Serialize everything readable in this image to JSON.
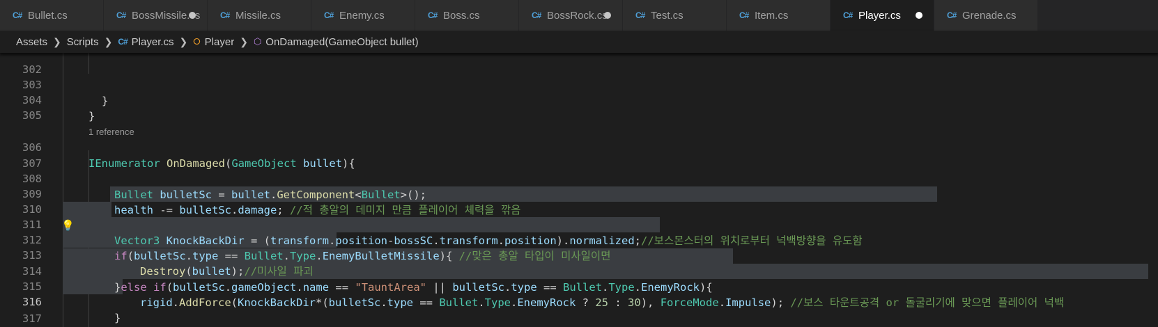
{
  "tabs": [
    {
      "label": "Bullet.cs",
      "modified": false,
      "active": false
    },
    {
      "label": "BossMissile.cs",
      "modified": true,
      "active": false
    },
    {
      "label": "Missile.cs",
      "modified": false,
      "active": false
    },
    {
      "label": "Enemy.cs",
      "modified": false,
      "active": false
    },
    {
      "label": "Boss.cs",
      "modified": false,
      "active": false
    },
    {
      "label": "BossRock.cs",
      "modified": true,
      "active": false
    },
    {
      "label": "Test.cs",
      "modified": false,
      "active": false
    },
    {
      "label": "Item.cs",
      "modified": false,
      "active": false
    },
    {
      "label": "Player.cs",
      "modified": true,
      "active": true
    },
    {
      "label": "Grenade.cs",
      "modified": false,
      "active": false
    }
  ],
  "tab_icon_text": "C#",
  "breadcrumb": {
    "folder1": "Assets",
    "folder2": "Scripts",
    "file": "Player.cs",
    "class": "Player",
    "method": "OnDamaged(GameObject bullet)"
  },
  "codelens": "1 reference",
  "line_numbers": [
    "302",
    "303",
    "304",
    "305",
    "306",
    "307",
    "308",
    "309",
    "310",
    "311",
    "312",
    "313",
    "314",
    "315",
    "316",
    "317"
  ],
  "code": {
    "l303": "}",
    "l304": "}",
    "l306": {
      "t1": "IEnumerator",
      "t2": "OnDamaged",
      "t3": "(",
      "t4": "GameObject",
      "t5": "bullet",
      "t6": "){"
    },
    "l308": {
      "t1": "Bullet",
      "t2": "bulletSc",
      "t3": " = ",
      "t4": "bullet",
      "t5": ".",
      "t6": "GetComponent",
      "t7": "<",
      "t8": "Bullet",
      "t9": ">();"
    },
    "l309": {
      "t1": "health",
      "t2": " -= ",
      "t3": "bulletSc",
      "t4": ".",
      "t5": "damage",
      "t6": "; ",
      "t7": "//적 총알의 데미지 만큼 플레이어 체력을 깎음"
    },
    "l310": {
      "t1": "Vector3",
      "t2": "KnockBackDir",
      "t3": " = (",
      "t4": "transform",
      "t5": ".",
      "t6": "position",
      "t7": "-",
      "t8": "bossSC",
      "t9": ".",
      "t10": "transform",
      "t11": ".",
      "t12": "position",
      "t13": ").",
      "t14": "normalized",
      "t15": ";",
      "t16": "//보스몬스터의 위치로부터 넉백방향을 유도함"
    },
    "l312": {
      "t1": "if",
      "t2": "(",
      "t3": "bulletSc",
      "t4": ".",
      "t5": "type",
      "t6": " == ",
      "t7": "Bullet",
      "t8": ".",
      "t9": "Type",
      "t10": ".",
      "t11": "EnemyBulletMissile",
      "t12": "){ ",
      "t13": "//맞은 총알 타입이 미사일이면"
    },
    "l313": {
      "t1": "Destroy",
      "t2": "(",
      "t3": "bullet",
      "t4": ");",
      "t5": "//미사일 파괴"
    },
    "l314": {
      "t1": "}",
      "t2": "else",
      "t3": "if",
      "t4": "(",
      "t5": "bulletSc",
      "t6": ".",
      "t7": "gameObject",
      "t8": ".",
      "t9": "name",
      "t10": " == ",
      "t11": "\"TauntArea\"",
      "t12": " || ",
      "t13": "bulletSc",
      "t14": ".",
      "t15": "type",
      "t16": " == ",
      "t17": "Bullet",
      "t18": ".",
      "t19": "Type",
      "t20": ".",
      "t21": "EnemyRock",
      "t22": "){"
    },
    "l315": {
      "t1": "rigid",
      "t2": ".",
      "t3": "AddForce",
      "t4": "(",
      "t5": "KnockBackDir",
      "t6": "*(",
      "t7": "bulletSc",
      "t8": ".",
      "t9": "type",
      "t10": " == ",
      "t11": "Bullet",
      "t12": ".",
      "t13": "Type",
      "t14": ".",
      "t15": "EnemyRock",
      "t16": " ? ",
      "t17": "25",
      "t18": " : ",
      "t19": "30",
      "t20": "), ",
      "t21": "ForceMode",
      "t22": ".",
      "t23": "Impulse",
      "t24": "); ",
      "t25": "//보스 타운트공격 or 돌굴리기에 맞으면 플레이어 넉백"
    },
    "l316": "}"
  },
  "colors": {
    "keyword": "#c586c0",
    "type": "#4ec9b0",
    "function": "#dcdcaa",
    "variable": "#9cdcfe",
    "string": "#ce9178",
    "number": "#b5cea8",
    "comment": "#6a9955",
    "selection": "#3a3d41"
  },
  "icons": {
    "lightbulb": "lightbulb-icon",
    "tab_file": "csharp-file-icon",
    "class": "class-icon",
    "method": "method-cube-icon"
  }
}
